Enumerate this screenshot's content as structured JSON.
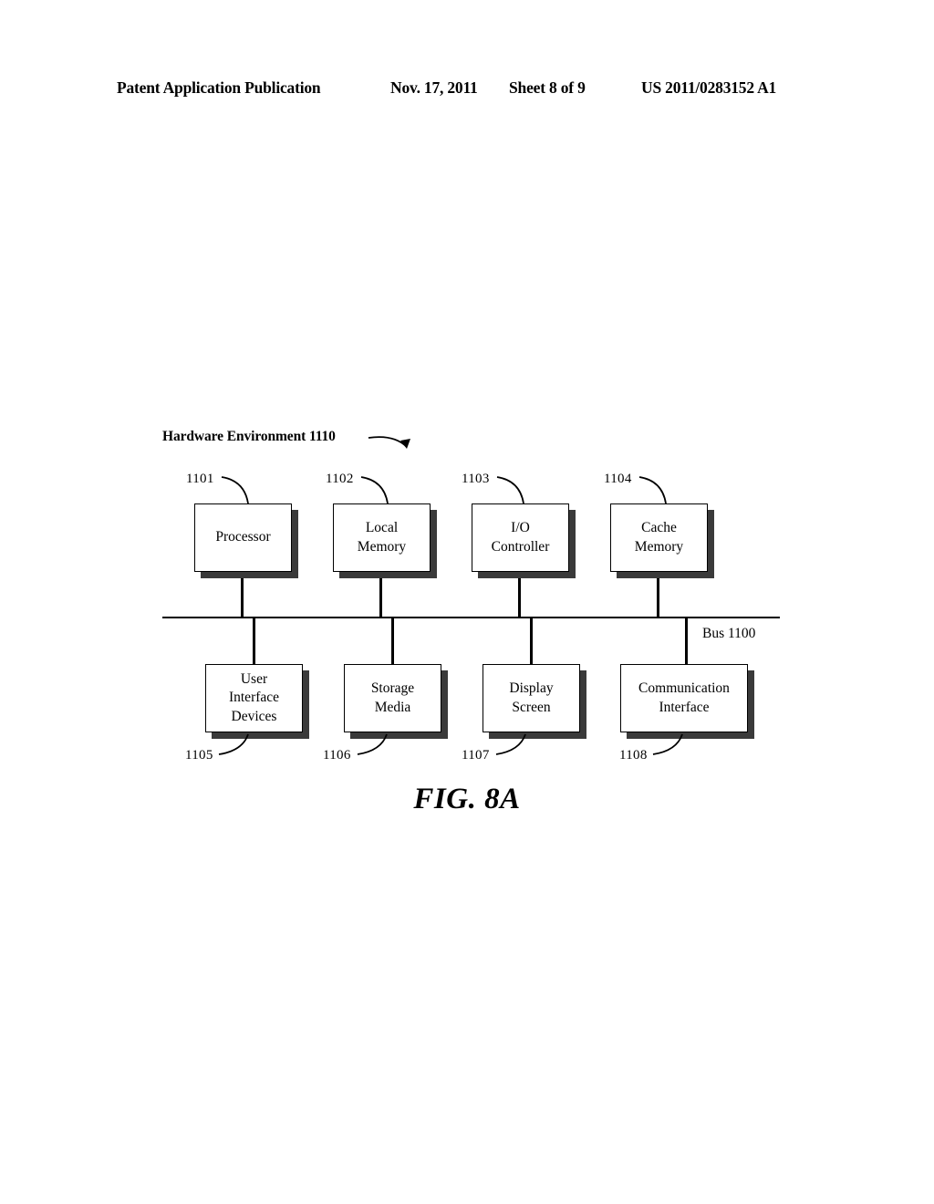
{
  "header": {
    "publication": "Patent Application Publication",
    "date": "Nov. 17, 2011",
    "sheet": "Sheet 8 of 9",
    "patent_number": "US 2011/0283152 A1"
  },
  "figure": {
    "caption": "FIG. 8A",
    "environment_title": "Hardware Environment 1110",
    "bus_label": "Bus 1100",
    "top_row": [
      {
        "ref": "1101",
        "label": "Processor",
        "lines": [
          "Processor"
        ]
      },
      {
        "ref": "1102",
        "label": "Local Memory",
        "lines": [
          "Local",
          "Memory"
        ]
      },
      {
        "ref": "1103",
        "label": "I/O Controller",
        "lines": [
          "I/O",
          "Controller"
        ]
      },
      {
        "ref": "1104",
        "label": "Cache Memory",
        "lines": [
          "Cache",
          "Memory"
        ]
      }
    ],
    "bottom_row": [
      {
        "ref": "1105",
        "label": "User Interface Devices",
        "lines": [
          "User",
          "Interface",
          "Devices"
        ]
      },
      {
        "ref": "1106",
        "label": "Storage Media",
        "lines": [
          "Storage",
          "Media"
        ]
      },
      {
        "ref": "1107",
        "label": "Display Screen",
        "lines": [
          "Display",
          "Screen"
        ]
      },
      {
        "ref": "1108",
        "label": "Communication Interface",
        "lines": [
          "Communication",
          "Interface"
        ]
      }
    ]
  }
}
